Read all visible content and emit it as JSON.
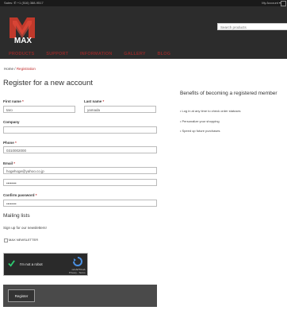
{
  "topbar": {
    "left_text": "Sales:  ✆  +1 (516) 388-9517",
    "account": "My Account ▾"
  },
  "header": {
    "logo_text": "MAX",
    "search_placeholder": "Search products"
  },
  "nav": [
    "PRODUCTS",
    "SUPPORT",
    "INFORMATION",
    "GALLERY",
    "BLOG"
  ],
  "breadcrumb": {
    "home": "Home",
    "sep": "/",
    "current": "Registration"
  },
  "form": {
    "title": "Register for a new account",
    "first_name_label": "First name",
    "first_name_value": "taro",
    "last_name_label": "Last name",
    "last_name_value": "yamada",
    "company_label": "Company",
    "company_value": "",
    "phone_label": "Phone",
    "phone_value": "0310002000",
    "email_label": "Email",
    "email_value": "hogehoge@yahoo.co.jp",
    "password_value": "••••••••",
    "confirm_label": "Confirm password",
    "confirm_value": "••••••••",
    "required_mark": "*"
  },
  "mailing": {
    "title": "Mailing lists",
    "note": "Sign up for our newsletters!",
    "newsletter_label": "MAX NEWSLETTER"
  },
  "captcha": {
    "label": "I'm not a robot",
    "brand": "reCAPTCHA",
    "links": "Privacy - Terms"
  },
  "register_button": "Register",
  "benefits": {
    "title": "Benefits of becoming a registered member",
    "items": [
      "Log in at any time to check order statuses",
      "Personalize your shopping",
      "Speed up future purchases"
    ]
  }
}
